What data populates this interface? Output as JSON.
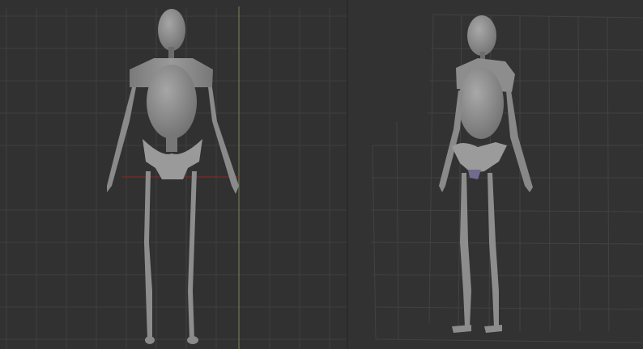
{
  "app": {
    "description_title": "",
    "viewports": [
      {
        "id": "front",
        "grid": true,
        "axes": true
      },
      {
        "id": "side",
        "grid": true,
        "axes": false
      }
    ]
  },
  "colors": {
    "background": "#2f2f2f",
    "grid": "#3d3d3d",
    "grid_major": "#4a4a4a",
    "axis_red": "#8a2a2a",
    "axis_green": "#6d7a58",
    "model": "#8c8c8c",
    "model_dark": "#6e6e6e",
    "model_light": "#a3a3a3",
    "accent_purple": "#6f6c8f"
  },
  "icons": {
    "figure_front": "mannequin-front",
    "figure_side": "mannequin-side"
  }
}
